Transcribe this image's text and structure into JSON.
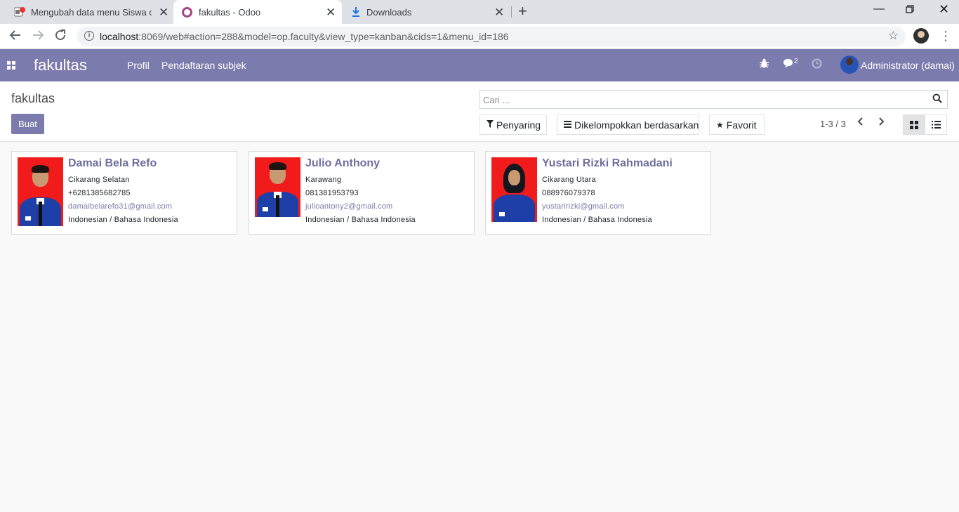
{
  "browser": {
    "tabs": [
      {
        "title": "Mengubah data  menu Siswa on",
        "active": false
      },
      {
        "title": "fakultas - Odoo",
        "active": true
      },
      {
        "title": "Downloads",
        "active": false
      }
    ],
    "url_host": "localhost",
    "url_rest": ":8069/web#action=288&model=op.faculty&view_type=kanban&cids=1&menu_id=186"
  },
  "navbar": {
    "brand": "fakultas",
    "menu": [
      "Profil",
      "Pendaftaran subjek"
    ],
    "chat_count": "2",
    "user": "Administrator (damai)",
    "color": "#7c7bad"
  },
  "control_panel": {
    "breadcrumb": "fakultas",
    "create_label": "Buat",
    "search_placeholder": "Cari ...",
    "filter_label": "Penyaring",
    "group_label": "Dikelompokkan berdasarkan",
    "favorite_label": "Favorit",
    "pager": "1-3 / 3"
  },
  "kanban": [
    {
      "name": "Damai Bela Refo",
      "city": "Cikarang Selatan",
      "phone": "+6281385682785",
      "email": "damaibelarefo31@gmail.com",
      "language": "Indonesian / Bahasa Indonesia"
    },
    {
      "name": "Julio Anthony",
      "city": "Karawang",
      "phone": "081381953793",
      "email": "julioantony2@gmail.com",
      "language": "Indonesian / Bahasa Indonesia"
    },
    {
      "name": "Yustari Rizki Rahmadani",
      "city": "Cikarang Utara",
      "phone": "088976079378",
      "email": "yustaririzki@gmail.com",
      "language": "Indonesian / Bahasa Indonesia"
    }
  ]
}
